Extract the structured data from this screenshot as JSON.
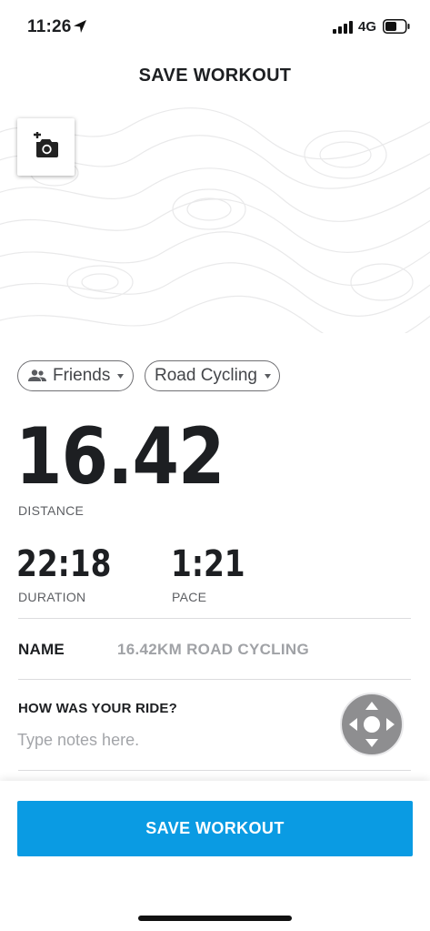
{
  "status_bar": {
    "time": "11:26",
    "network": "4G",
    "icons": [
      "location-arrow-icon",
      "signal-bars-icon",
      "battery-icon"
    ]
  },
  "header": {
    "title": "SAVE WORKOUT"
  },
  "photo": {
    "icon": "add-photo-icon"
  },
  "chips": {
    "privacy": {
      "label": "Friends",
      "icon": "friends-icon"
    },
    "activity_type": {
      "label": "Road Cycling"
    }
  },
  "stats": {
    "distance": {
      "value": "16.42",
      "label": "DISTANCE"
    },
    "duration": {
      "value": "22:18",
      "label": "DURATION"
    },
    "pace": {
      "value": "1:21",
      "label": "PACE"
    }
  },
  "name_field": {
    "label": "NAME",
    "value": "16.42KM ROAD CYCLING"
  },
  "notes": {
    "heading": "HOW WAS YOUR RIDE?",
    "placeholder": "Type notes here."
  },
  "footer": {
    "save_label": "SAVE WORKOUT"
  },
  "colors": {
    "accent": "#0a9be3",
    "text": "#1d1f22",
    "muted": "#a0a2a6"
  }
}
